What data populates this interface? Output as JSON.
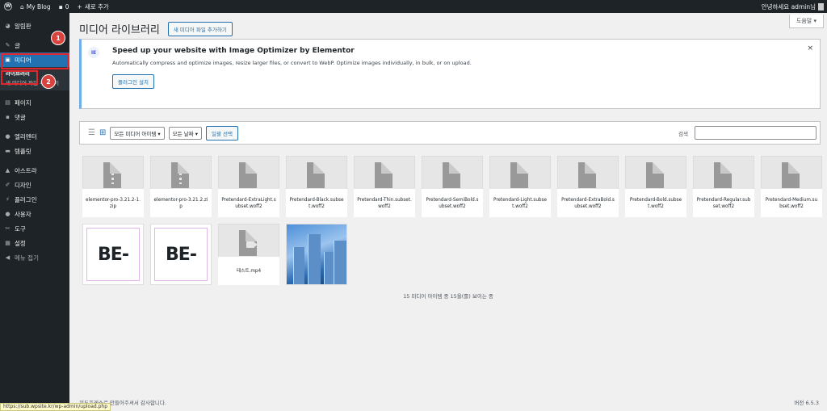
{
  "admin_bar": {
    "wp_logo": "wordpress-icon",
    "site_name": "My Blog",
    "comments_count": "0",
    "new_label": "새로 추가",
    "greeting": "안녕하세요 admin님"
  },
  "menu": {
    "items": [
      {
        "label": "알림판",
        "icon": "dashboard-icon"
      },
      {
        "label": "글",
        "icon": "pin-icon"
      },
      {
        "label": "미디어",
        "icon": "media-icon",
        "current": true
      },
      {
        "label": "페이지",
        "icon": "page-icon"
      },
      {
        "label": "댓글",
        "icon": "comment-icon"
      },
      {
        "label": "엘리멘터",
        "icon": "elementor-icon"
      },
      {
        "label": "템플릿",
        "icon": "folder-icon"
      },
      {
        "label": "아스트라",
        "icon": "astra-icon"
      },
      {
        "label": "디자인",
        "icon": "brush-icon"
      },
      {
        "label": "플러그인",
        "icon": "plugin-icon"
      },
      {
        "label": "사용자",
        "icon": "user-icon"
      },
      {
        "label": "도구",
        "icon": "wrench-icon"
      },
      {
        "label": "설정",
        "icon": "settings-icon"
      },
      {
        "label": "메뉴 접기",
        "icon": "collapse-icon"
      }
    ],
    "submenu": [
      "라이브러리",
      "새 미디어 파일 추가하기"
    ]
  },
  "annotations": {
    "badge1": "1",
    "badge2": "2",
    "highlight_color": "#e1262d"
  },
  "page": {
    "title": "미디어 라이브러리",
    "add_button": "새 미디어 파일 추가하기",
    "help": "도움말 ▾"
  },
  "notice": {
    "logo": "IE",
    "title": "Speed up your website with Image Optimizer by Elementor",
    "desc": "Automatically compress and optimize images, resize larger files, or convert to WebP. Optimize images individually, in bulk, or on upload.",
    "install": "플러그인 설치",
    "dismiss": "×"
  },
  "toolbar": {
    "filter_type": "모든 미디어 아이템 ▾",
    "filter_date": "모든 날짜 ▾",
    "bulk_select": "일괄 선택",
    "search_label": "검색"
  },
  "files": [
    {
      "name": "elementor-pro-3.21.2-1.zip",
      "kind": "zip"
    },
    {
      "name": "elementor-pro-3.21.2.zip",
      "kind": "zip"
    },
    {
      "name": "Pretendard-ExtraLight.subset.woff2",
      "kind": "doc"
    },
    {
      "name": "Pretendard-Black.subset.woff2",
      "kind": "doc"
    },
    {
      "name": "Pretendard-Thin.subset.woff2",
      "kind": "doc"
    },
    {
      "name": "Pretendard-SemiBold.subset.woff2",
      "kind": "doc"
    },
    {
      "name": "Pretendard-Light.subset.woff2",
      "kind": "doc"
    },
    {
      "name": "Pretendard-ExtraBold.subset.woff2",
      "kind": "doc"
    },
    {
      "name": "Pretendard-Bold.subset.woff2",
      "kind": "doc"
    },
    {
      "name": "Pretendard-Regular.subset.woff2",
      "kind": "doc"
    },
    {
      "name": "Pretendard-Medium.subset.woff2",
      "kind": "doc"
    },
    {
      "name": "BE-",
      "kind": "image"
    },
    {
      "name": "BE-",
      "kind": "image"
    },
    {
      "name": "테스트.mp4",
      "kind": "video"
    },
    {
      "name": "",
      "kind": "photo"
    }
  ],
  "count_text": "15 미디어 아이템 중 15을(를) 보이는 중",
  "footer": {
    "thanks": "워드프레스로 만들어주셔서 감사합니다.",
    "version": "버전 6.5.3"
  },
  "status_url": "https://sub.wpsite.kr/wp-admin/upload.php"
}
